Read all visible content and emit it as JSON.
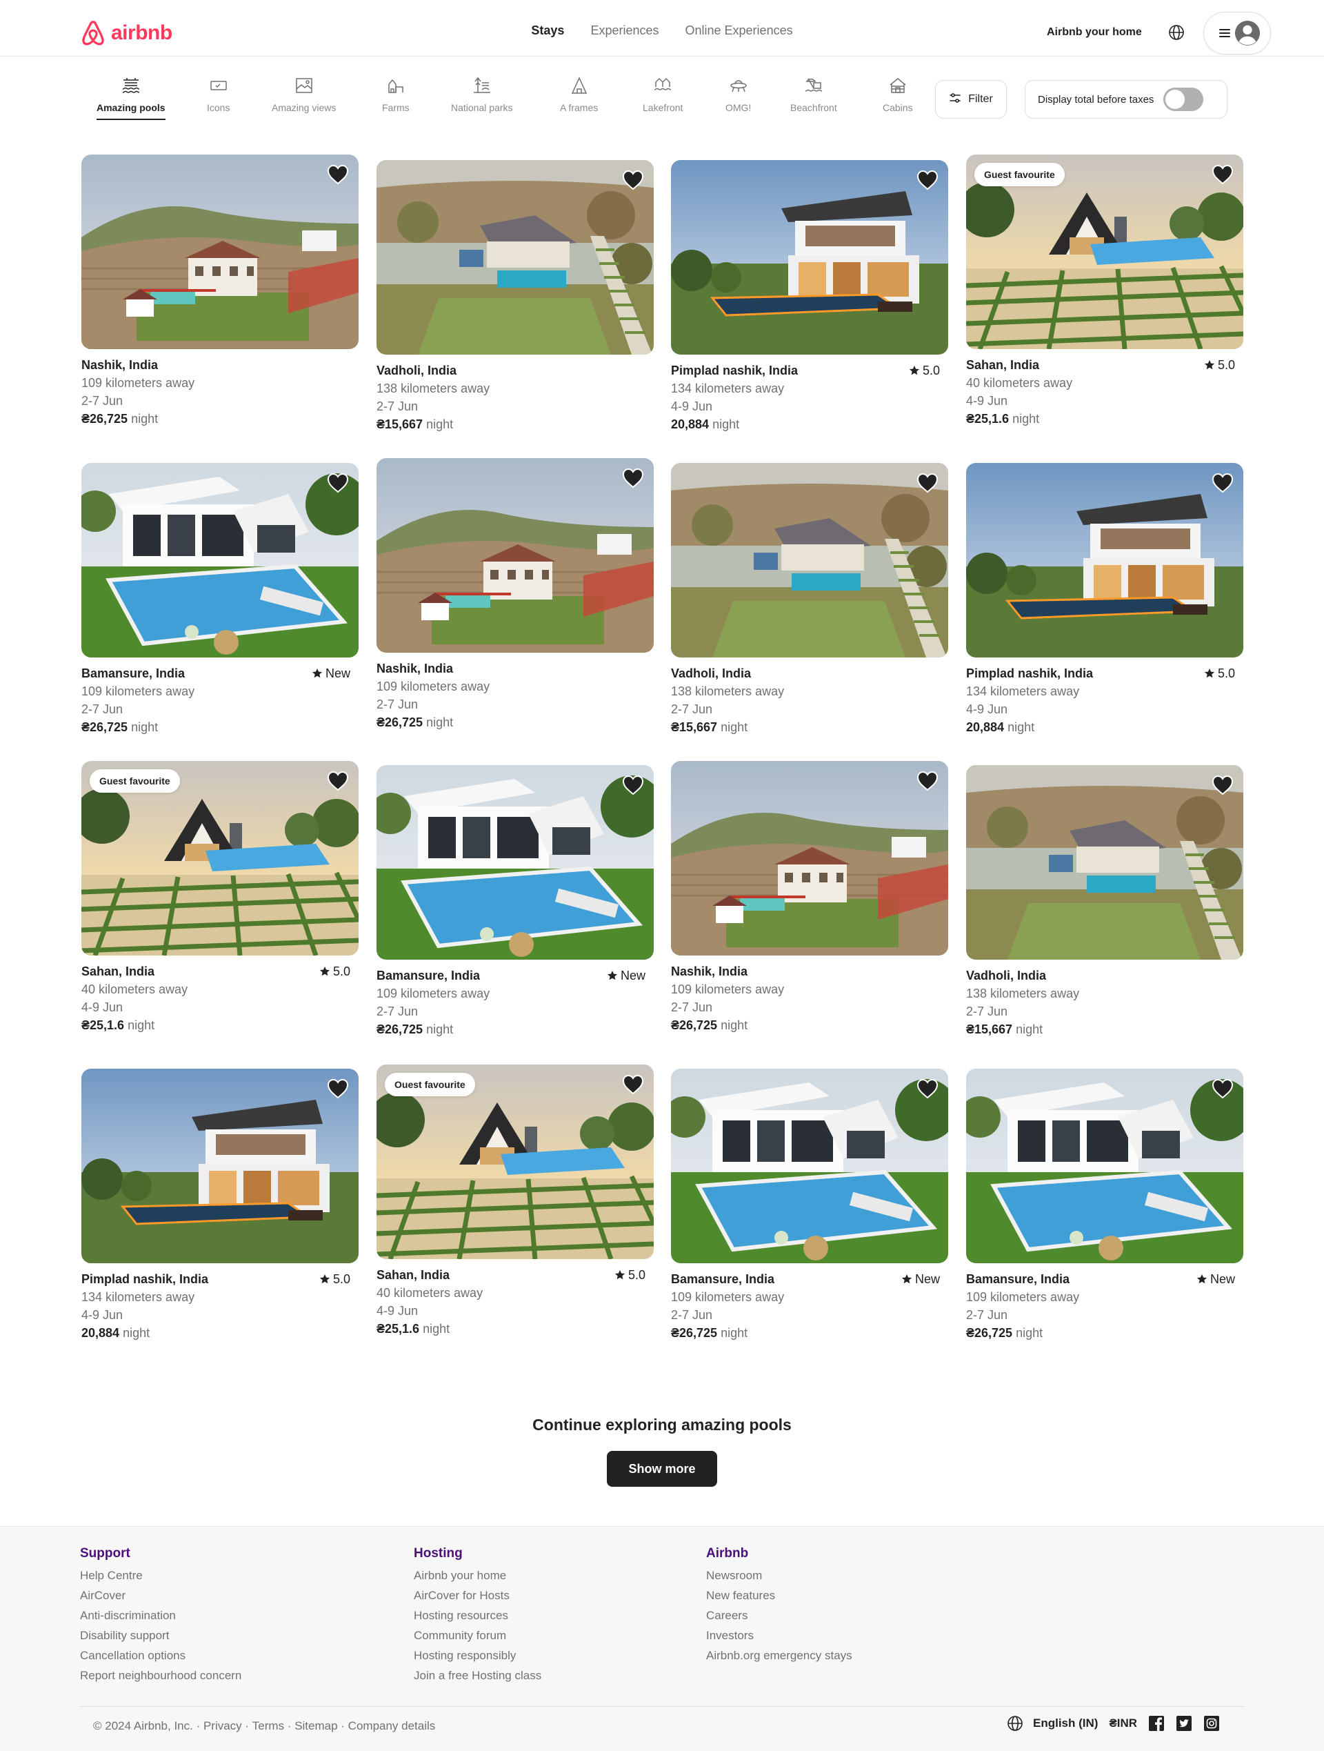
{
  "brand": {
    "name": "airbnb",
    "color": "#ff385c"
  },
  "header": {
    "tabs": [
      "Stays",
      "Experiences",
      "Online Experiences"
    ],
    "host_link": "Airbnb your home"
  },
  "categories": [
    {
      "label": "Amazing pools",
      "icon": "pool-icon"
    },
    {
      "label": "Icons",
      "icon": "ticket-icon"
    },
    {
      "label": "Amazing views",
      "icon": "view-icon"
    },
    {
      "label": "Farms",
      "icon": "farm-icon"
    },
    {
      "label": "National parks",
      "icon": "park-icon"
    },
    {
      "label": "A frames",
      "icon": "a-frame-icon"
    },
    {
      "label": "Lakefront",
      "icon": "lakefront-icon"
    },
    {
      "label": "OMG!",
      "icon": "ufo-icon"
    },
    {
      "label": "Beachfront",
      "icon": "beach-icon"
    },
    {
      "label": "Cabins",
      "icon": "cabin-icon"
    }
  ],
  "filter": {
    "label": "Filter"
  },
  "tax_toggle": {
    "label": "Display total before taxes",
    "on": false
  },
  "listings": [
    {
      "title": "Nashik, India",
      "distance": "109 kilometers away",
      "dates": "2-7 Jun",
      "price": "₴26,725",
      "unit": "night",
      "rating": "",
      "badge": "",
      "scene": "terrace"
    },
    {
      "title": "Vadholi, India",
      "distance": "138 kilometers away",
      "dates": "2-7 Jun",
      "price": "₴15,667",
      "unit": "night",
      "rating": "",
      "badge": "",
      "scene": "aerial"
    },
    {
      "title": "Pimplad nashik, India",
      "distance": "134 kilometers away",
      "dates": "4-9 Jun",
      "price": "20,884",
      "unit": "night",
      "rating": "5.0",
      "badge": "",
      "scene": "modern"
    },
    {
      "title": "Sahan, India",
      "distance": "40 kilometers away",
      "dates": "4-9 Jun",
      "price": "₴25,1.6",
      "unit": "night",
      "rating": "5.0",
      "badge": "Guest favourite",
      "scene": "aframe"
    },
    {
      "title": "Bamansure, India",
      "distance": "109 kilometers away",
      "dates": "2-7 Jun",
      "price": "₴26,725",
      "unit": "night",
      "rating": "New",
      "badge": "",
      "scene": "villa"
    },
    {
      "title": "Nashik, India",
      "distance": "109 kilometers away",
      "dates": "2-7 Jun",
      "price": "₴26,725",
      "unit": "night",
      "rating": "",
      "badge": "",
      "scene": "terrace"
    },
    {
      "title": "Vadholi, India",
      "distance": "138 kilometers away",
      "dates": "2-7 Jun",
      "price": "₴15,667",
      "unit": "night",
      "rating": "",
      "badge": "",
      "scene": "aerial"
    },
    {
      "title": "Pimplad nashik, India",
      "distance": "134 kilometers away",
      "dates": "4-9 Jun",
      "price": "20,884",
      "unit": "night",
      "rating": "5.0",
      "badge": "",
      "scene": "modern"
    },
    {
      "title": "Sahan, India",
      "distance": "40 kilometers away",
      "dates": "4-9 Jun",
      "price": "₴25,1.6",
      "unit": "night",
      "rating": "5.0",
      "badge": "Guest favourite",
      "scene": "aframe"
    },
    {
      "title": "Bamansure, India",
      "distance": "109 kilometers away",
      "dates": "2-7 Jun",
      "price": "₴26,725",
      "unit": "night",
      "rating": "New",
      "badge": "",
      "scene": "villa"
    },
    {
      "title": "Nashik, India",
      "distance": "109 kilometers away",
      "dates": "2-7 Jun",
      "price": "₴26,725",
      "unit": "night",
      "rating": "",
      "badge": "",
      "scene": "terrace"
    },
    {
      "title": "Vadholi, India",
      "distance": "138 kilometers away",
      "dates": "2-7 Jun",
      "price": "₴15,667",
      "unit": "night",
      "rating": "",
      "badge": "",
      "scene": "aerial"
    },
    {
      "title": "Pimplad nashik, India",
      "distance": "134 kilometers away",
      "dates": "4-9 Jun",
      "price": "20,884",
      "unit": "night",
      "rating": "5.0",
      "badge": "",
      "scene": "modern"
    },
    {
      "title": "Sahan, India",
      "distance": "40 kilometers away",
      "dates": "4-9 Jun",
      "price": "₴25,1.6",
      "unit": "night",
      "rating": "5.0",
      "badge": "Ouest favourite",
      "scene": "aframe"
    },
    {
      "title": "Bamansure, India",
      "distance": "109 kilometers away",
      "dates": "2-7 Jun",
      "price": "₴26,725",
      "unit": "night",
      "rating": "New",
      "badge": "",
      "scene": "villa"
    },
    {
      "title": "Bamansure, India",
      "distance": "109 kilometers away",
      "dates": "2-7 Jun",
      "price": "₴26,725",
      "unit": "night",
      "rating": "New",
      "badge": "",
      "scene": "villa"
    }
  ],
  "continue": {
    "title": "Continue exploring amazing pools",
    "button": "Show more"
  },
  "footer": {
    "columns": [
      {
        "heading": "Support",
        "links": [
          "Help Centre",
          "AirCover",
          "Anti-discrimination",
          "Disability support",
          "Cancellation options",
          "Report neighbourhood concern"
        ]
      },
      {
        "heading": "Hosting",
        "links": [
          "Airbnb your home",
          "AirCover for Hosts",
          "Hosting resources",
          "Community forum",
          "Hosting responsibly",
          "Join a free Hosting class"
        ]
      },
      {
        "heading": "Airbnb",
        "links": [
          "Newsroom",
          "New features",
          "Careers",
          "Investors",
          "Airbnb.org emergency stays"
        ]
      }
    ],
    "copyright": "© 2024 Airbnb, Inc.",
    "legal_links": [
      "Privacy",
      "Terms",
      "Sitemap",
      "Company details"
    ],
    "language": "English (IN)",
    "currency": "₴INR",
    "social": [
      "facebook-icon",
      "twitter-icon",
      "instagram-icon"
    ]
  }
}
